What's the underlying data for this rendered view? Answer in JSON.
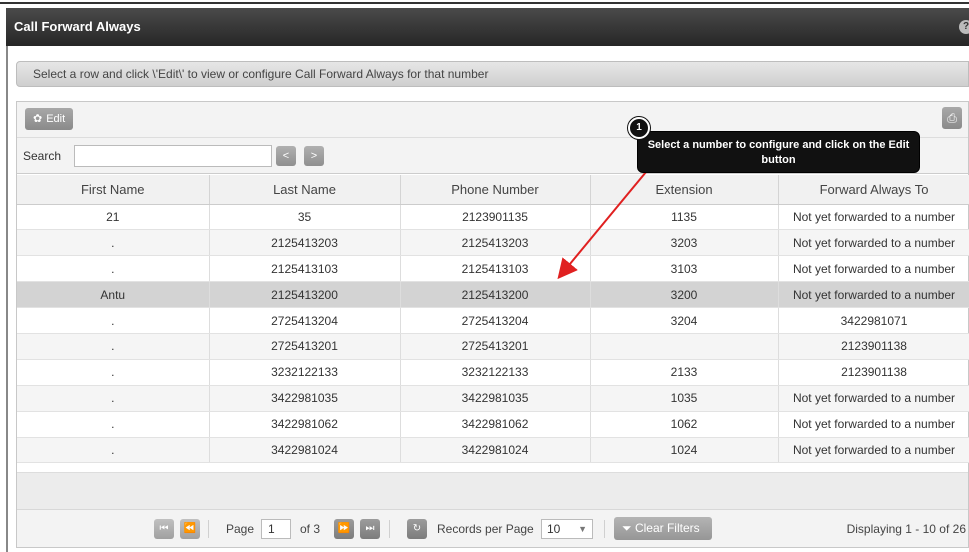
{
  "window": {
    "title": "Call Forward Always",
    "help_icon": "?"
  },
  "instruction": "Select a row and click \\'Edit\\' to view or configure Call Forward Always for that number",
  "toolbar": {
    "edit_label": "Edit",
    "gear_icon": "gear-icon",
    "print_icon": "printer-icon"
  },
  "search": {
    "label": "Search",
    "value": "",
    "prev": "<",
    "next": ">"
  },
  "table": {
    "columns": [
      "First Name",
      "Last Name",
      "Phone Number",
      "Extension",
      "Forward Always To"
    ],
    "rows": [
      [
        "21",
        "35",
        "2123901135",
        "1135",
        "Not yet forwarded to a number"
      ],
      [
        ".",
        "2125413203",
        "2125413203",
        "3203",
        "Not yet forwarded to a number"
      ],
      [
        ".",
        "2125413103",
        "2125413103",
        "3103",
        "Not yet forwarded to a number"
      ],
      [
        "Antu",
        "2125413200",
        "2125413200",
        "3200",
        "Not yet forwarded to a number"
      ],
      [
        ".",
        "2725413204",
        "2725413204",
        "3204",
        "3422981071"
      ],
      [
        ".",
        "2725413201",
        "2725413201",
        "",
        "2123901138"
      ],
      [
        ".",
        "3232122133",
        "3232122133",
        "2133",
        "2123901138"
      ],
      [
        ".",
        "3422981035",
        "3422981035",
        "1035",
        "Not yet forwarded to a number"
      ],
      [
        ".",
        "3422981062",
        "3422981062",
        "1062",
        "Not yet forwarded to a number"
      ],
      [
        ".",
        "3422981024",
        "3422981024",
        "1024",
        "Not yet forwarded to a number"
      ]
    ],
    "selected_row": 3
  },
  "pager": {
    "page_label": "Page",
    "page_value": "1",
    "of_label": "of 3",
    "records_label": "Records per Page",
    "records_value": "10",
    "clear_filters": "Clear Filters",
    "displaying": "Displaying 1 - 10 of 26"
  },
  "callout": {
    "badge": "1",
    "text": "Select a number to configure and click on the Edit button"
  }
}
